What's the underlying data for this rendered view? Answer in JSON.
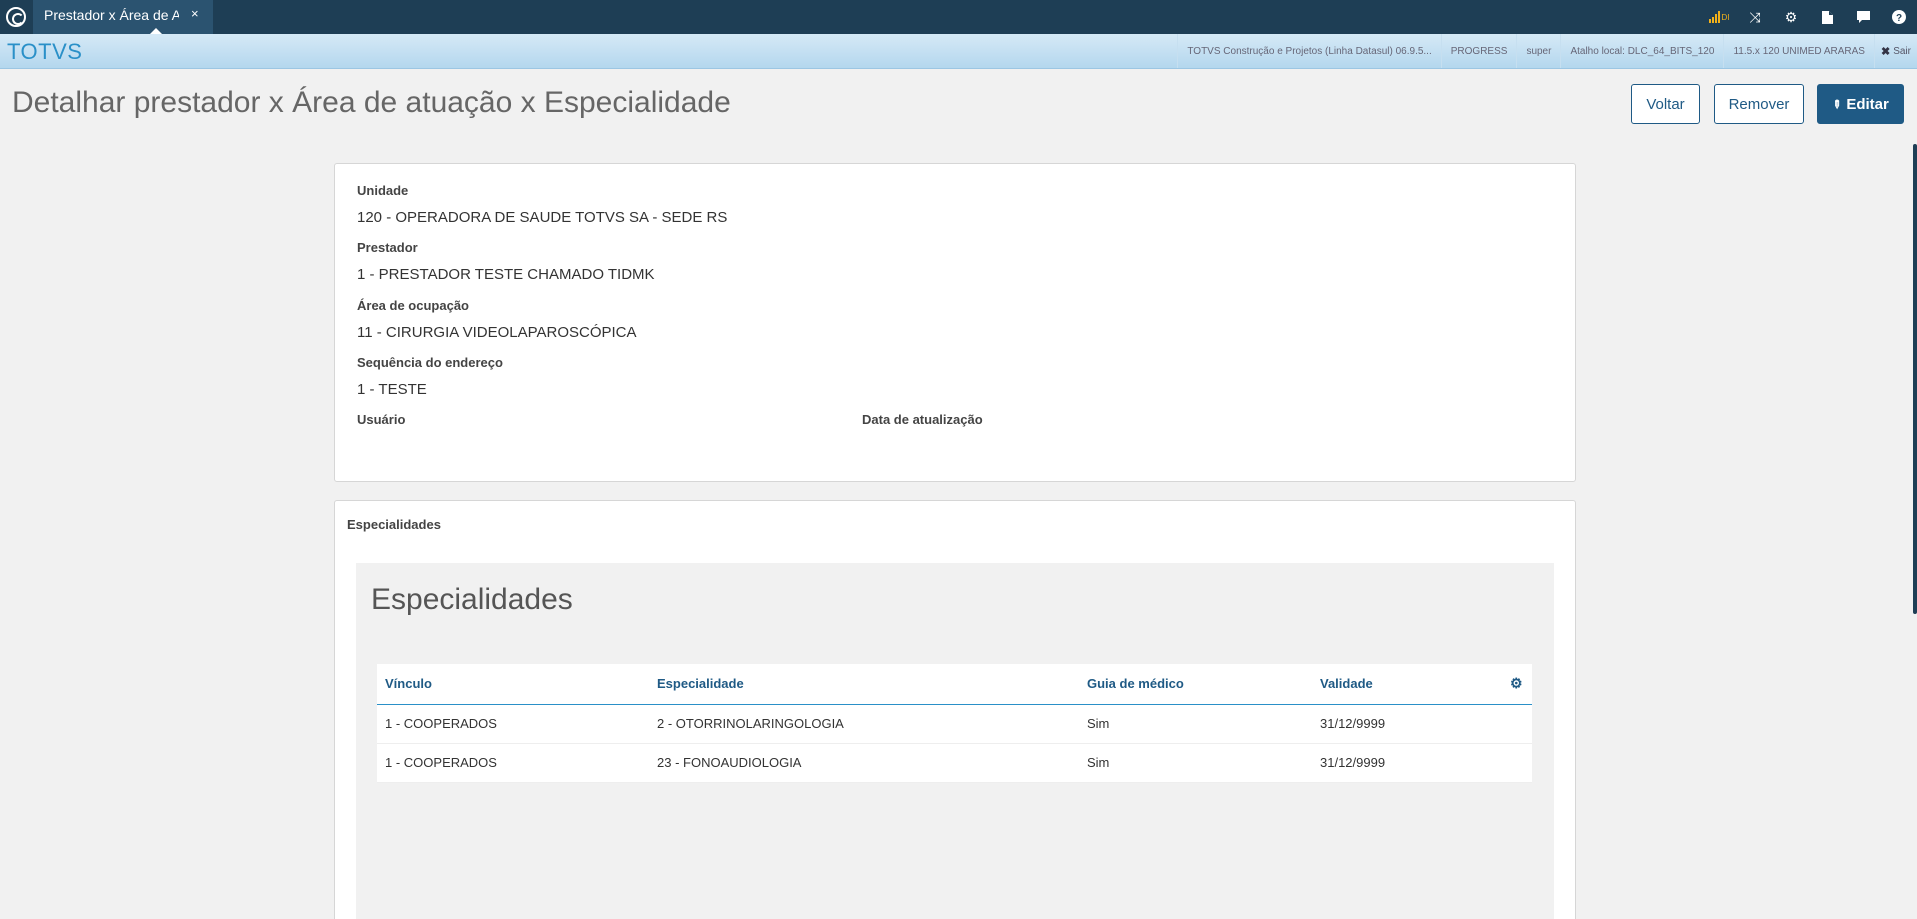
{
  "tab": {
    "label": "Prestador x Área de At",
    "close": "×"
  },
  "top_icons": [
    "signal-icon",
    "shuffle-icon",
    "gear-icon",
    "document-icon",
    "chat-icon",
    "help-icon"
  ],
  "signal_label": "DI",
  "brand": "TOTVS",
  "info": [
    "TOTVS Construção e Projetos (Linha Datasul) 06.9.5...",
    "PROGRESS",
    "super",
    "Atalho local: DLC_64_BITS_120",
    "11.5.x 120 UNIMED ARARAS"
  ],
  "logout": {
    "icon": "✖",
    "label": "Sair"
  },
  "page": {
    "title": "Detalhar prestador x Área de atuação x Especialidade",
    "buttons": {
      "back": "Voltar",
      "remove": "Remover",
      "edit": "Editar"
    }
  },
  "details": {
    "unit_label": "Unidade",
    "unit_value": "120 - OPERADORA DE SAUDE TOTVS SA - SEDE RS",
    "provider_label": "Prestador",
    "provider_value": "1 - PRESTADOR TESTE CHAMADO TIDMK",
    "area_label": "Área de ocupação",
    "area_value": "11 - CIRURGIA VIDEOLAPAROSCÓPICA",
    "address_label": "Sequência do endereço",
    "address_value": "1 - TESTE",
    "user_label": "Usuário",
    "updated_label": "Data de atualização"
  },
  "specialties": {
    "section_label": "Especialidades",
    "grid_title": "Especialidades",
    "columns": [
      "Vínculo",
      "Especialidade",
      "Guia de médico",
      "Validade"
    ],
    "rows": [
      [
        "1 - COOPERADOS",
        "2 - OTORRINOLARINGOLOGIA",
        "Sim",
        "31/12/9999"
      ],
      [
        "1 - COOPERADOS",
        "23 - FONOAUDIOLOGIA",
        "Sim",
        "31/12/9999"
      ]
    ]
  },
  "colors": {
    "navy": "#1e3e55",
    "primary": "#1f5a85",
    "brand": "#2a90c8"
  }
}
